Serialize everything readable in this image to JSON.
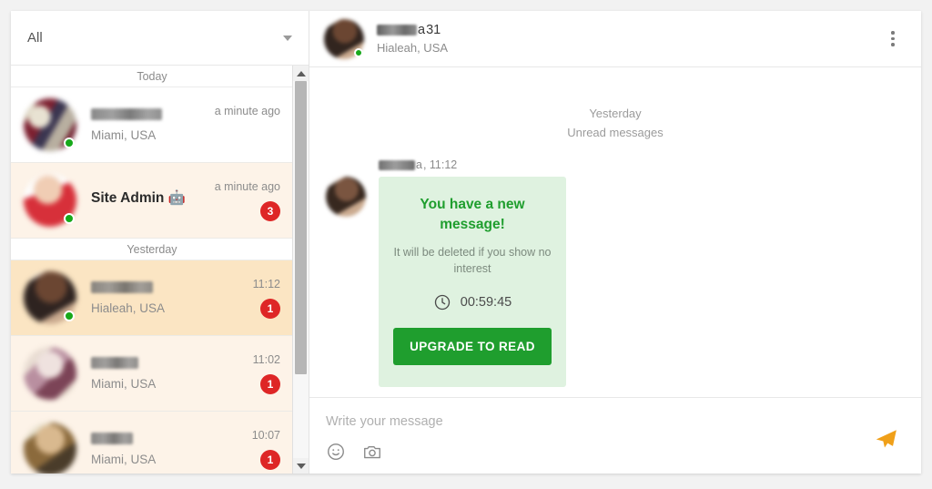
{
  "sidebar": {
    "filter": {
      "label": "All",
      "icon": "chevron-down-icon"
    },
    "groups": [
      {
        "day_label": "Today",
        "rows": [
          {
            "name": "",
            "name_redacted": true,
            "location": "Miami, USA",
            "time": "a minute ago",
            "badge": "",
            "online": true,
            "state": "read"
          },
          {
            "name": "Site Admin 🤖",
            "name_redacted": false,
            "location": "",
            "time": "a minute ago",
            "badge": "3",
            "online": true,
            "state": "unread"
          }
        ]
      },
      {
        "day_label": "Yesterday",
        "rows": [
          {
            "name": "",
            "name_redacted": true,
            "location": "Hialeah, USA",
            "time": "11:12",
            "badge": "1",
            "online": true,
            "state": "active"
          },
          {
            "name": "",
            "name_redacted": true,
            "location": "Miami, USA",
            "time": "11:02",
            "badge": "1",
            "online": false,
            "state": "unread"
          },
          {
            "name": "",
            "name_redacted": true,
            "location": "Miami, USA",
            "time": "10:07",
            "badge": "1",
            "online": false,
            "state": "unread"
          }
        ]
      }
    ],
    "scrollbar": {
      "up_icon": "scroll-up-arrow-icon",
      "down_icon": "scroll-down-arrow-icon"
    }
  },
  "chat": {
    "header": {
      "name_redacted_suffix": "a",
      "age": "31",
      "location": "Hialeah, USA",
      "online": true,
      "menu_icon": "kebab-menu-icon"
    },
    "separators": {
      "day": "Yesterday",
      "unread": "Unread messages"
    },
    "message": {
      "sender_suffix": "a",
      "sender_time": ", 11:12",
      "title": "You have a new message!",
      "subtitle": "It will be deleted if you show no interest",
      "timer": "00:59:45",
      "timer_icon": "clock-icon",
      "cta_label": "UPGRADE TO READ"
    },
    "composer": {
      "placeholder": "Write your message",
      "value": "",
      "emoji_icon": "emoji-smiley-icon",
      "camera_icon": "camera-icon",
      "send_icon": "send-paper-plane-icon"
    }
  },
  "colors": {
    "badge_red": "#de2626",
    "online_green": "#17a81a",
    "bubble_green": "#dff2e0",
    "cta_green": "#1f9e2e",
    "send_orange": "#f0a019",
    "row_active": "#fbe5c3",
    "row_unread": "#fdf3e8"
  }
}
